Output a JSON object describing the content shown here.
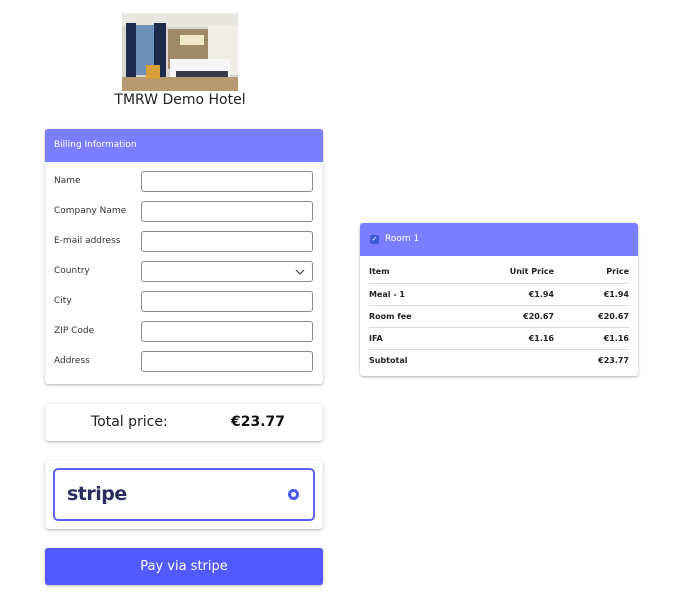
{
  "hotel": {
    "name": "TMRW Demo Hotel"
  },
  "billing": {
    "title": "Billing Information",
    "fields": [
      {
        "label": "Name",
        "value": "",
        "type": "text"
      },
      {
        "label": "Company Name",
        "value": "",
        "type": "text"
      },
      {
        "label": "E-mail address",
        "value": "",
        "type": "text"
      },
      {
        "label": "Country",
        "value": "",
        "type": "select"
      },
      {
        "label": "City",
        "value": "",
        "type": "text"
      },
      {
        "label": "ZIP Code",
        "value": "",
        "type": "text"
      },
      {
        "label": "Address",
        "value": "",
        "type": "text"
      }
    ]
  },
  "total": {
    "label": "Total price:",
    "value": "€23.77"
  },
  "payment": {
    "provider": "stripe",
    "selected": true,
    "button_label": "Pay via stripe"
  },
  "room": {
    "title": "Room 1",
    "checked": true,
    "columns": [
      "Item",
      "Unit Price",
      "Price"
    ],
    "rows": [
      {
        "item": "Meal - 1",
        "unit": "€1.94",
        "price": "€1.94"
      },
      {
        "item": "Room fee",
        "unit": "€20.67",
        "price": "€20.67"
      },
      {
        "item": "IFA",
        "unit": "€1.16",
        "price": "€1.16"
      },
      {
        "item": "Subtotal",
        "unit": "",
        "price": "€23.77"
      }
    ]
  },
  "colors": {
    "header": "#7b7fff",
    "button": "#5259ff",
    "accent": "#4a58f0"
  }
}
